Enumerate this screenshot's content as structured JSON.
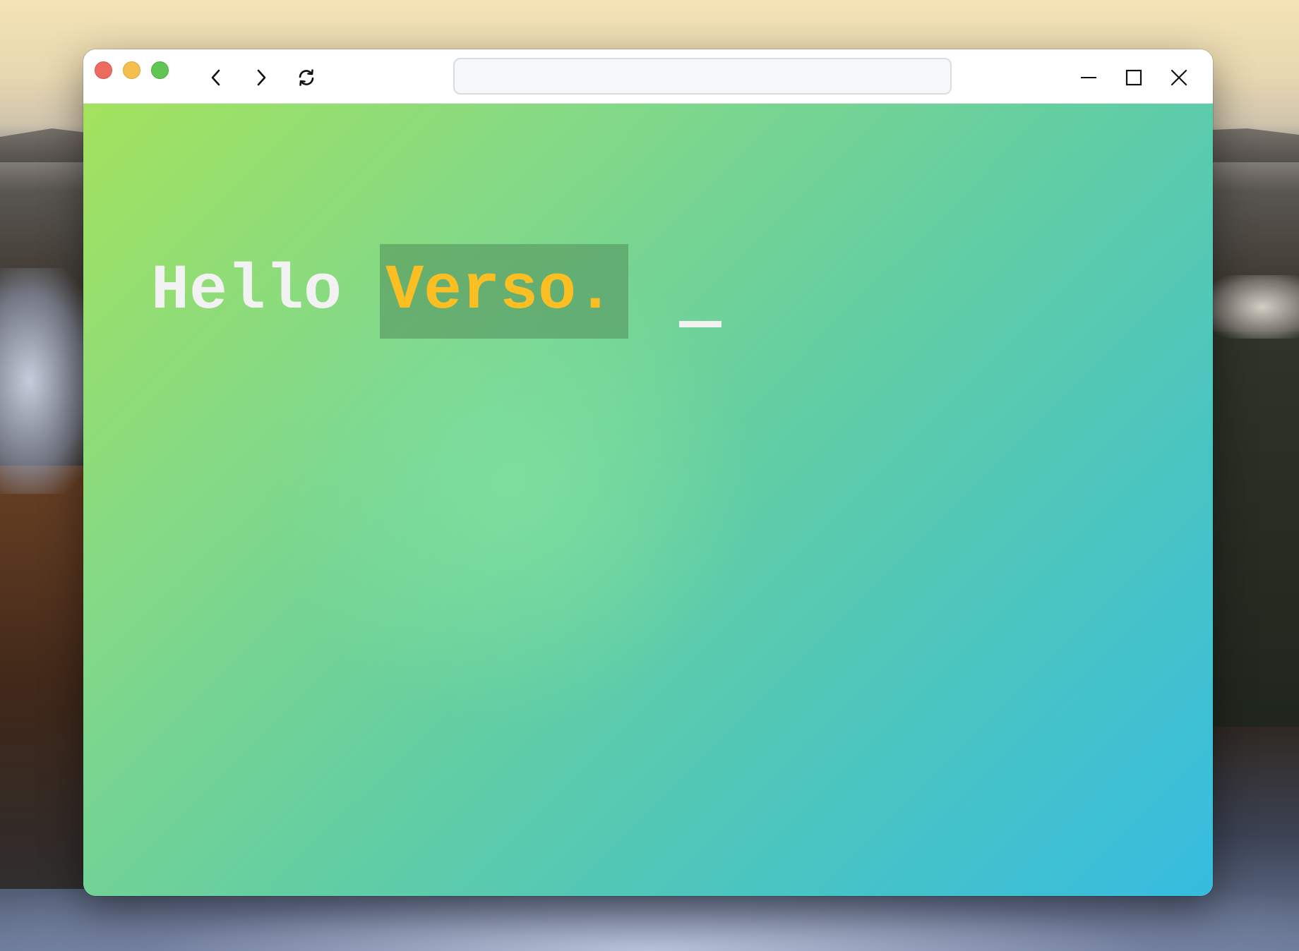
{
  "browser": {
    "address_bar": {
      "value": "",
      "placeholder": ""
    },
    "nav": {
      "back_icon": "chevron-left-icon",
      "forward_icon": "chevron-right-icon",
      "reload_icon": "reload-icon"
    },
    "window_controls": {
      "minimize_icon": "minimize-icon",
      "maximize_icon": "maximize-icon",
      "close_icon": "close-icon"
    },
    "traffic_lights": {
      "close_color": "#ed6a5e",
      "minimize_color": "#f5bf4f",
      "zoom_color": "#61c554"
    }
  },
  "page": {
    "greeting": "Hello",
    "highlight": "Verso.",
    "cursor": "_",
    "colors": {
      "greeting": "#f2f2f2",
      "highlight_text": "#fbbf24",
      "gradient_start": "#a3e25d",
      "gradient_end": "#36bce0"
    }
  }
}
